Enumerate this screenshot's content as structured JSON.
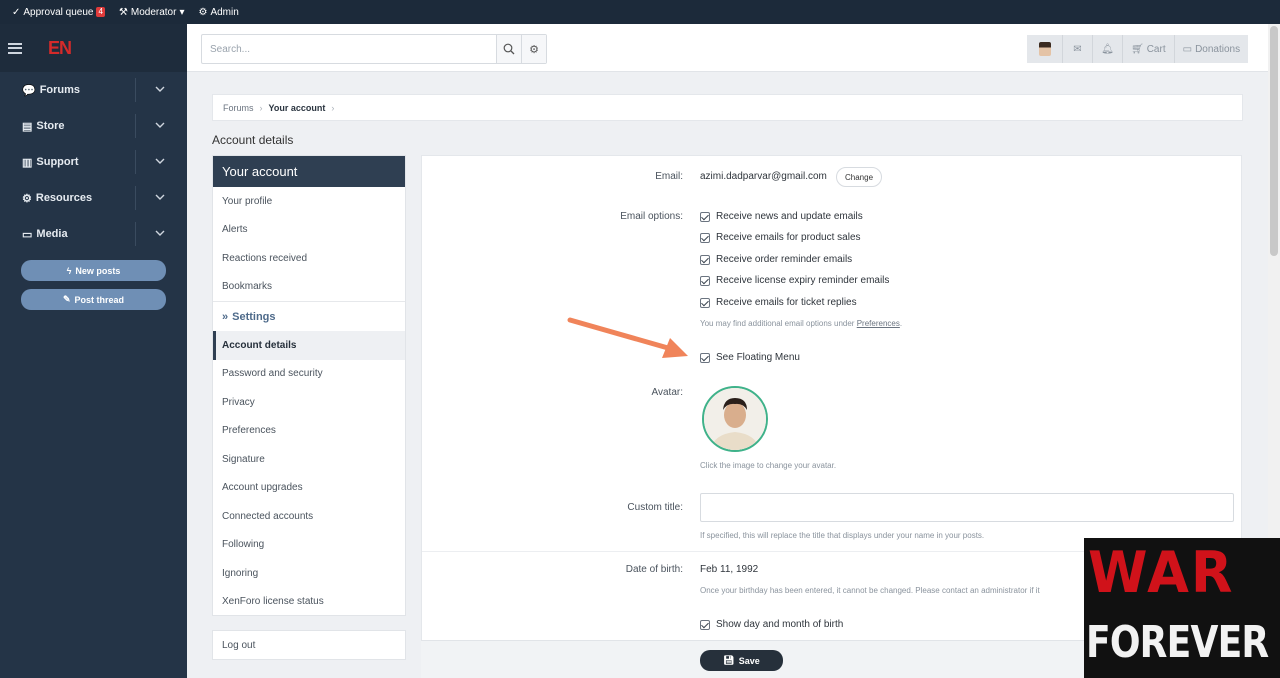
{
  "adminbar": {
    "approval_label": "Approval queue",
    "approval_count": "4",
    "moderator_label": "Moderator",
    "admin_label": "Admin"
  },
  "sidebar": {
    "logo": "EN",
    "items": [
      {
        "label": "Forums",
        "icon": "chat-bubbles-icon"
      },
      {
        "label": "Store",
        "icon": "store-icon"
      },
      {
        "label": "Support",
        "icon": "support-icon"
      },
      {
        "label": "Resources",
        "icon": "gear-icon"
      },
      {
        "label": "Media",
        "icon": "media-icon"
      }
    ],
    "new_posts_label": "New posts",
    "post_thread_label": "Post thread"
  },
  "header": {
    "search_placeholder": "Search...",
    "cart_label": "Cart",
    "donations_label": "Donations"
  },
  "breadcrumb": {
    "items": [
      "Forums",
      "Your account"
    ]
  },
  "page": {
    "title": "Account details"
  },
  "account_menu": {
    "header": "Your account",
    "items_top": [
      "Your profile",
      "Alerts",
      "Reactions received",
      "Bookmarks"
    ],
    "settings_label": "Settings",
    "items_settings": [
      "Account details",
      "Password and security",
      "Privacy",
      "Preferences",
      "Signature",
      "Account upgrades",
      "Connected accounts",
      "Following",
      "Ignoring",
      "XenForo license status"
    ],
    "active": "Account details",
    "logout": "Log out"
  },
  "form": {
    "email_label": "Email:",
    "email_value": "azimi.dadparvar@gmail.com",
    "change_label": "Change",
    "email_options_label": "Email options:",
    "email_options": [
      {
        "label": "Receive news and update emails",
        "checked": true
      },
      {
        "label": "Receive emails for product sales",
        "checked": true
      },
      {
        "label": "Receive order reminder emails",
        "checked": true
      },
      {
        "label": "Receive license expiry reminder emails",
        "checked": true
      },
      {
        "label": "Receive emails for ticket replies",
        "checked": true
      }
    ],
    "email_hint_prefix": "You may find additional email options under",
    "email_hint_link": "Preferences",
    "email_hint_suffix": ".",
    "floating_menu_label": "See Floating Menu",
    "floating_menu_checked": true,
    "avatar_label": "Avatar:",
    "avatar_hint": "Click the image to change your avatar.",
    "custom_title_label": "Custom title:",
    "custom_title_value": "",
    "custom_title_hint": "If specified, this will replace the title that displays under your name in your posts.",
    "dob_label": "Date of birth:",
    "dob_value": "Feb 11, 1992",
    "dob_hint": "Once your birthday has been entered, it cannot be changed. Please contact an administrator if it",
    "show_dob_label": "Show day and month of birth",
    "show_dob_checked": true,
    "save_label": "Save"
  },
  "watermark": {
    "line1": "WAR",
    "line2": "FOREVER"
  },
  "colors": {
    "sidebar_bg": "#243447",
    "accent_dark": "#2f3f52",
    "button_blue": "#6f8fb5",
    "arrow_orange": "#f0845a"
  }
}
